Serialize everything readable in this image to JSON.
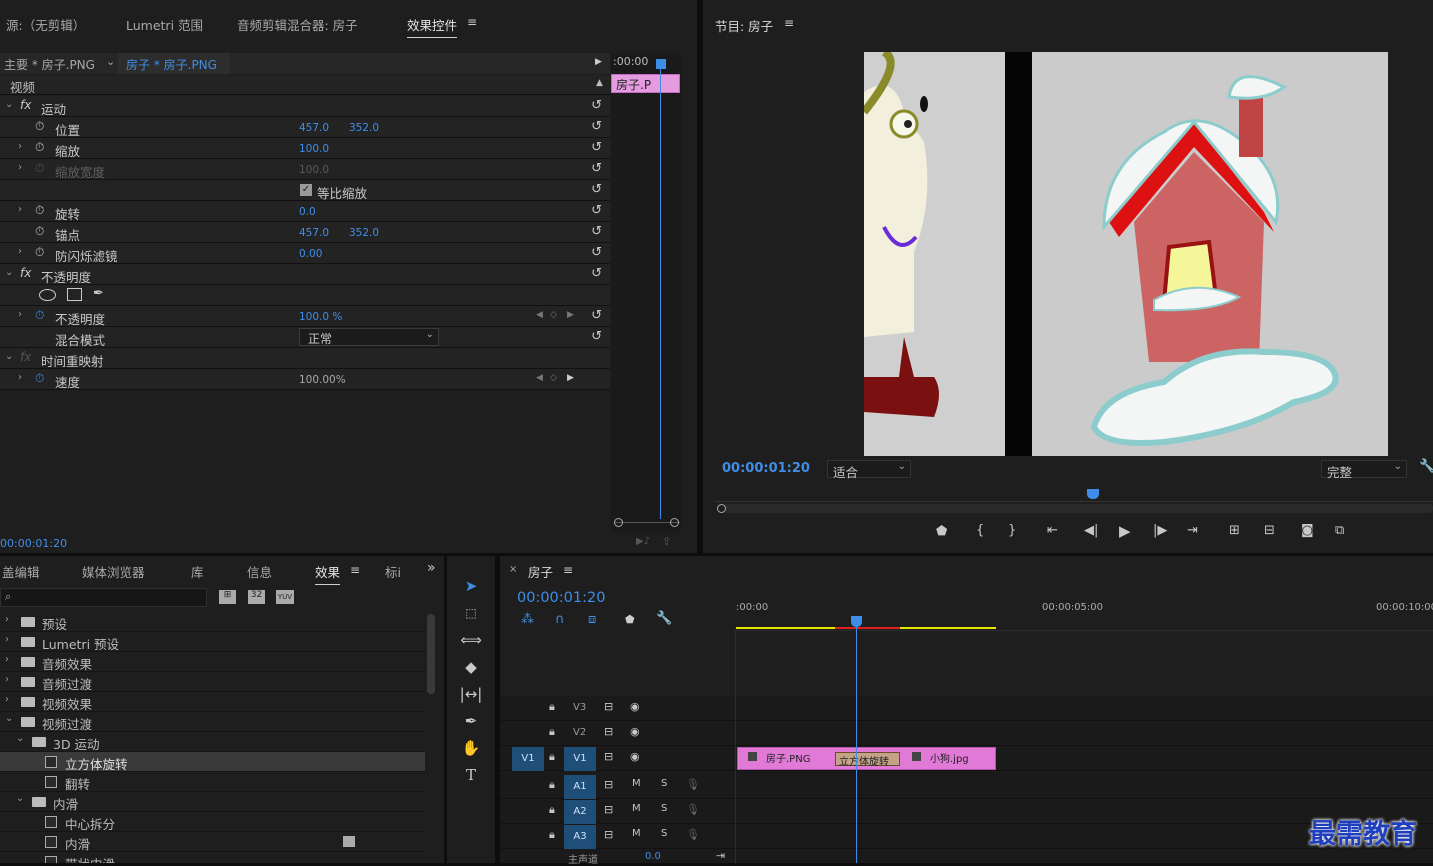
{
  "top_tabs": {
    "source": "源:（无剪辑）",
    "lumetri": "Lumetri 范围",
    "audio_mixer": "音频剪辑混合器: 房子",
    "effect_controls": "效果控件"
  },
  "effect_controls": {
    "master": "主要 * 房子.PNG",
    "clip": "房子 * 房子.PNG",
    "mini_time": ":00:00",
    "mini_clip": "房子.P",
    "section_video": "视频",
    "motion": "运动",
    "position": "位置",
    "position_x": "457.0",
    "position_y": "352.0",
    "scale": "缩放",
    "scale_v": "100.0",
    "scale_width": "缩放宽度",
    "scale_width_v": "100.0",
    "uniform_scale": "等比缩放",
    "rotation": "旋转",
    "rotation_v": "0.0",
    "anchor": "锚点",
    "anchor_x": "457.0",
    "anchor_y": "352.0",
    "antiflicker": "防闪烁滤镜",
    "antiflicker_v": "0.00",
    "opacity_group": "不透明度",
    "opacity": "不透明度",
    "opacity_v": "100.0 %",
    "blend_mode": "混合模式",
    "blend_value": "正常",
    "time_remap": "时间重映射",
    "speed": "速度",
    "speed_v": "100.00%",
    "timecode": "00:00:01:20"
  },
  "program": {
    "title": "节目: 房子",
    "timecode": "00:00:01:20",
    "fit": "适合",
    "quality": "完整"
  },
  "effects_panel": {
    "tabs": {
      "edit": "盖编辑",
      "media": "媒体浏览器",
      "library": "库",
      "info": "信息",
      "effects": "效果",
      "markers": "标i"
    },
    "icons": {
      "b1": "32",
      "b2": "32",
      "b3": "YUV"
    },
    "items": {
      "presets": "预设",
      "lumetri": "Lumetri 预设",
      "audio_effects": "音频效果",
      "audio_trans": "音频过渡",
      "video_effects": "视频效果",
      "video_trans": "视频过渡",
      "motion3d": "3D 运动",
      "cube": "立方体旋转",
      "flip": "翻转",
      "slide": "内滑",
      "center_split": "中心拆分",
      "inner_slide": "内滑",
      "band_slide": "带状内滑"
    }
  },
  "timeline": {
    "tab": "房子",
    "timecode": "00:00:01:20",
    "ruler": {
      "t0": ":00:00",
      "t5": "00:00:05:00",
      "t10": "00:00:10:00"
    },
    "tracks": {
      "v3": "V3",
      "v2": "V2",
      "v1": "V1",
      "v1_src": "V1",
      "a1": "A1",
      "a2": "A2",
      "a3": "A3",
      "m": "M",
      "s": "S",
      "master": "主声道",
      "master_v": "0.0"
    },
    "clips": {
      "house": "房子.PNG",
      "transition": "立方体旋转",
      "dog": "小狗.jpg"
    }
  },
  "watermark": "最需教育",
  "colors": {
    "accent": "#3e8ee8",
    "clip": "#e07ad6",
    "bg": "#1e1e1e"
  }
}
